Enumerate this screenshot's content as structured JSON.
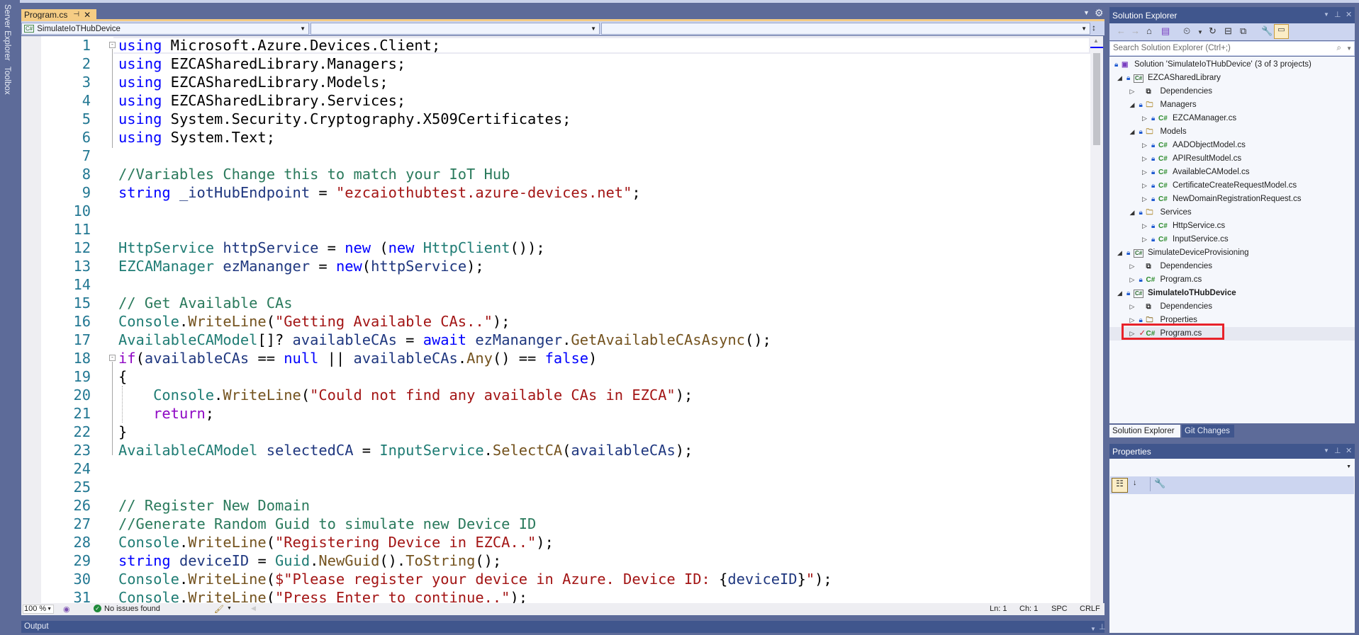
{
  "left_strip": {
    "items": [
      "Server Explorer",
      "Toolbox"
    ]
  },
  "document_tab": {
    "title": "Program.cs",
    "pin_icon": "pin-icon",
    "close_icon": "close-icon",
    "active_color": "#f5cc84"
  },
  "navbar": {
    "project": "SimulateIoTHubDevice",
    "type_member": "",
    "member": ""
  },
  "syntax_colors": {
    "kw": "#0000ff",
    "ctl": "#8f08c4",
    "type": "#1f7c74",
    "str": "#a31515",
    "method": "#74531f",
    "var": "#1f377f",
    "cm": "#2a7a5c",
    "pl": "#000000"
  },
  "code": [
    {
      "n": "1",
      "t": [
        [
          "kw",
          "using"
        ],
        [
          "pl",
          " Microsoft.Azure.Devices.Client;"
        ]
      ]
    },
    {
      "n": "2",
      "t": [
        [
          "kw",
          "using"
        ],
        [
          "pl",
          " EZCASharedLibrary.Managers;"
        ]
      ]
    },
    {
      "n": "3",
      "t": [
        [
          "kw",
          "using"
        ],
        [
          "pl",
          " EZCASharedLibrary.Models;"
        ]
      ]
    },
    {
      "n": "4",
      "t": [
        [
          "kw",
          "using"
        ],
        [
          "pl",
          " EZCASharedLibrary.Services;"
        ]
      ]
    },
    {
      "n": "5",
      "t": [
        [
          "kw",
          "using"
        ],
        [
          "pl",
          " System.Security.Cryptography.X509Certificates;"
        ]
      ]
    },
    {
      "n": "6",
      "t": [
        [
          "kw",
          "using"
        ],
        [
          "pl",
          " System.Text;"
        ]
      ]
    },
    {
      "n": "7",
      "t": []
    },
    {
      "n": "8",
      "t": [
        [
          "cm",
          "//Variables Change this to match your IoT Hub"
        ]
      ]
    },
    {
      "n": "9",
      "t": [
        [
          "kw",
          "string"
        ],
        [
          "pl",
          " "
        ],
        [
          "var",
          "_iotHubEndpoint"
        ],
        [
          "pl",
          " = "
        ],
        [
          "str",
          "\"ezcaiothubtest.azure-devices.net\""
        ],
        [
          "pl",
          ";"
        ]
      ]
    },
    {
      "n": "10",
      "t": []
    },
    {
      "n": "11",
      "t": []
    },
    {
      "n": "12",
      "t": [
        [
          "type",
          "HttpService"
        ],
        [
          "pl",
          " "
        ],
        [
          "var",
          "httpService"
        ],
        [
          "pl",
          " = "
        ],
        [
          "kw",
          "new"
        ],
        [
          "pl",
          " ("
        ],
        [
          "kw",
          "new"
        ],
        [
          "pl",
          " "
        ],
        [
          "type",
          "HttpClient"
        ],
        [
          "pl",
          "());"
        ]
      ]
    },
    {
      "n": "13",
      "t": [
        [
          "type",
          "EZCAManager"
        ],
        [
          "pl",
          " "
        ],
        [
          "var",
          "ezMananger"
        ],
        [
          "pl",
          " = "
        ],
        [
          "kw",
          "new"
        ],
        [
          "pl",
          "("
        ],
        [
          "var",
          "httpService"
        ],
        [
          "pl",
          ");"
        ]
      ]
    },
    {
      "n": "14",
      "t": []
    },
    {
      "n": "15",
      "t": [
        [
          "cm",
          "// Get Available CAs"
        ]
      ]
    },
    {
      "n": "16",
      "t": [
        [
          "type",
          "Console"
        ],
        [
          "pl",
          "."
        ],
        [
          "method",
          "WriteLine"
        ],
        [
          "pl",
          "("
        ],
        [
          "str",
          "\"Getting Available CAs..\""
        ],
        [
          "pl",
          ");"
        ]
      ]
    },
    {
      "n": "17",
      "t": [
        [
          "type",
          "AvailableCAModel"
        ],
        [
          "pl",
          "[]? "
        ],
        [
          "var",
          "availableCAs"
        ],
        [
          "pl",
          " = "
        ],
        [
          "kw",
          "await"
        ],
        [
          "pl",
          " "
        ],
        [
          "var",
          "ezMananger"
        ],
        [
          "pl",
          "."
        ],
        [
          "method",
          "GetAvailableCAsAsync"
        ],
        [
          "pl",
          "();"
        ]
      ]
    },
    {
      "n": "18",
      "t": [
        [
          "ctl",
          "if"
        ],
        [
          "pl",
          "("
        ],
        [
          "var",
          "availableCAs"
        ],
        [
          "pl",
          " == "
        ],
        [
          "kw",
          "null"
        ],
        [
          "pl",
          " || "
        ],
        [
          "var",
          "availableCAs"
        ],
        [
          "pl",
          "."
        ],
        [
          "method",
          "Any"
        ],
        [
          "pl",
          "() == "
        ],
        [
          "kw",
          "false"
        ],
        [
          "pl",
          ")"
        ]
      ]
    },
    {
      "n": "19",
      "t": [
        [
          "pl",
          "{"
        ]
      ]
    },
    {
      "n": "20",
      "t": [
        [
          "pl",
          "    "
        ],
        [
          "type",
          "Console"
        ],
        [
          "pl",
          "."
        ],
        [
          "method",
          "WriteLine"
        ],
        [
          "pl",
          "("
        ],
        [
          "str",
          "\"Could not find any available CAs in EZCA\""
        ],
        [
          "pl",
          ");"
        ]
      ]
    },
    {
      "n": "21",
      "t": [
        [
          "pl",
          "    "
        ],
        [
          "ctl",
          "return"
        ],
        [
          "pl",
          ";"
        ]
      ]
    },
    {
      "n": "22",
      "t": [
        [
          "pl",
          "}"
        ]
      ]
    },
    {
      "n": "23",
      "t": [
        [
          "type",
          "AvailableCAModel"
        ],
        [
          "pl",
          " "
        ],
        [
          "var",
          "selectedCA"
        ],
        [
          "pl",
          " = "
        ],
        [
          "type",
          "InputService"
        ],
        [
          "pl",
          "."
        ],
        [
          "method",
          "SelectCA"
        ],
        [
          "pl",
          "("
        ],
        [
          "var",
          "availableCAs"
        ],
        [
          "pl",
          ");"
        ]
      ]
    },
    {
      "n": "24",
      "t": []
    },
    {
      "n": "25",
      "t": []
    },
    {
      "n": "26",
      "t": [
        [
          "cm",
          "// Register New Domain"
        ]
      ]
    },
    {
      "n": "27",
      "t": [
        [
          "cm",
          "//Generate Random Guid to simulate new Device ID"
        ]
      ]
    },
    {
      "n": "28",
      "t": [
        [
          "type",
          "Console"
        ],
        [
          "pl",
          "."
        ],
        [
          "method",
          "WriteLine"
        ],
        [
          "pl",
          "("
        ],
        [
          "str",
          "\"Registering Device in EZCA..\""
        ],
        [
          "pl",
          ");"
        ]
      ]
    },
    {
      "n": "29",
      "t": [
        [
          "kw",
          "string"
        ],
        [
          "pl",
          " "
        ],
        [
          "var",
          "deviceID"
        ],
        [
          "pl",
          " = "
        ],
        [
          "type",
          "Guid"
        ],
        [
          "pl",
          "."
        ],
        [
          "method",
          "NewGuid"
        ],
        [
          "pl",
          "()."
        ],
        [
          "method",
          "ToString"
        ],
        [
          "pl",
          "();"
        ]
      ]
    },
    {
      "n": "30",
      "t": [
        [
          "type",
          "Console"
        ],
        [
          "pl",
          "."
        ],
        [
          "method",
          "WriteLine"
        ],
        [
          "pl",
          "("
        ],
        [
          "str",
          "$\"Please register your device in Azure. Device ID: "
        ],
        [
          "pl",
          "{"
        ],
        [
          "var",
          "deviceID"
        ],
        [
          "pl",
          "}"
        ],
        [
          "str",
          "\""
        ],
        [
          "pl",
          ");"
        ]
      ]
    },
    {
      "n": "31",
      "t": [
        [
          "type",
          "Console"
        ],
        [
          "pl",
          "."
        ],
        [
          "method",
          "WriteLine"
        ],
        [
          "pl",
          "("
        ],
        [
          "str",
          "\"Press Enter to continue..\""
        ],
        [
          "pl",
          ");"
        ]
      ]
    }
  ],
  "statusbar": {
    "zoom": "100 %",
    "issues": "No issues found",
    "line": "Ln: 1",
    "col": "Ch: 1",
    "indent": "SPC",
    "eol": "CRLF"
  },
  "output": {
    "title": "Output"
  },
  "solution_explorer": {
    "title": "Solution Explorer",
    "search_placeholder": "Search Solution Explorer (Ctrl+;)",
    "tree": [
      {
        "level": 0,
        "exp": "",
        "lock": true,
        "icon": "sln",
        "label": "Solution 'SimulateIoTHubDevice' (3 of 3 projects)"
      },
      {
        "level": 1,
        "exp": "open",
        "lock": true,
        "icon": "proj",
        "label": "EZCASharedLibrary"
      },
      {
        "level": 2,
        "exp": "closed",
        "lock": false,
        "icon": "deps",
        "label": "Dependencies"
      },
      {
        "level": 2,
        "exp": "open",
        "lock": true,
        "icon": "folder",
        "label": "Managers"
      },
      {
        "level": 3,
        "exp": "closed",
        "lock": true,
        "icon": "cs",
        "label": "EZCAManager.cs"
      },
      {
        "level": 2,
        "exp": "open",
        "lock": true,
        "icon": "folder",
        "label": "Models"
      },
      {
        "level": 3,
        "exp": "closed",
        "lock": true,
        "icon": "cs",
        "label": "AADObjectModel.cs"
      },
      {
        "level": 3,
        "exp": "closed",
        "lock": true,
        "icon": "cs",
        "label": "APIResultModel.cs"
      },
      {
        "level": 3,
        "exp": "closed",
        "lock": true,
        "icon": "cs",
        "label": "AvailableCAModel.cs"
      },
      {
        "level": 3,
        "exp": "closed",
        "lock": true,
        "icon": "cs",
        "label": "CertificateCreateRequestModel.cs"
      },
      {
        "level": 3,
        "exp": "closed",
        "lock": true,
        "icon": "cs",
        "label": "NewDomainRegistrationRequest.cs"
      },
      {
        "level": 2,
        "exp": "open",
        "lock": true,
        "icon": "folder",
        "label": "Services"
      },
      {
        "level": 3,
        "exp": "closed",
        "lock": true,
        "icon": "cs",
        "label": "HttpService.cs"
      },
      {
        "level": 3,
        "exp": "closed",
        "lock": true,
        "icon": "cs",
        "label": "InputService.cs"
      },
      {
        "level": 1,
        "exp": "open",
        "lock": true,
        "icon": "proj",
        "label": "SimulateDeviceProvisioning"
      },
      {
        "level": 2,
        "exp": "closed",
        "lock": false,
        "icon": "deps",
        "label": "Dependencies"
      },
      {
        "level": 2,
        "exp": "closed",
        "lock": true,
        "icon": "cs",
        "label": "Program.cs"
      },
      {
        "level": 1,
        "exp": "open",
        "lock": true,
        "icon": "proj",
        "label": "SimulateIoTHubDevice",
        "bold": true
      },
      {
        "level": 2,
        "exp": "closed",
        "lock": false,
        "icon": "deps",
        "label": "Dependencies"
      },
      {
        "level": 2,
        "exp": "closed",
        "lock": true,
        "icon": "props",
        "label": "Properties"
      },
      {
        "level": 2,
        "exp": "closed",
        "lock": false,
        "check": true,
        "icon": "cs",
        "label": "Program.cs",
        "selected": true,
        "highlighted": true
      }
    ],
    "bottom_tabs": [
      "Solution Explorer",
      "Git Changes"
    ],
    "highlight_color": "#e8222a"
  },
  "properties": {
    "title": "Properties"
  }
}
